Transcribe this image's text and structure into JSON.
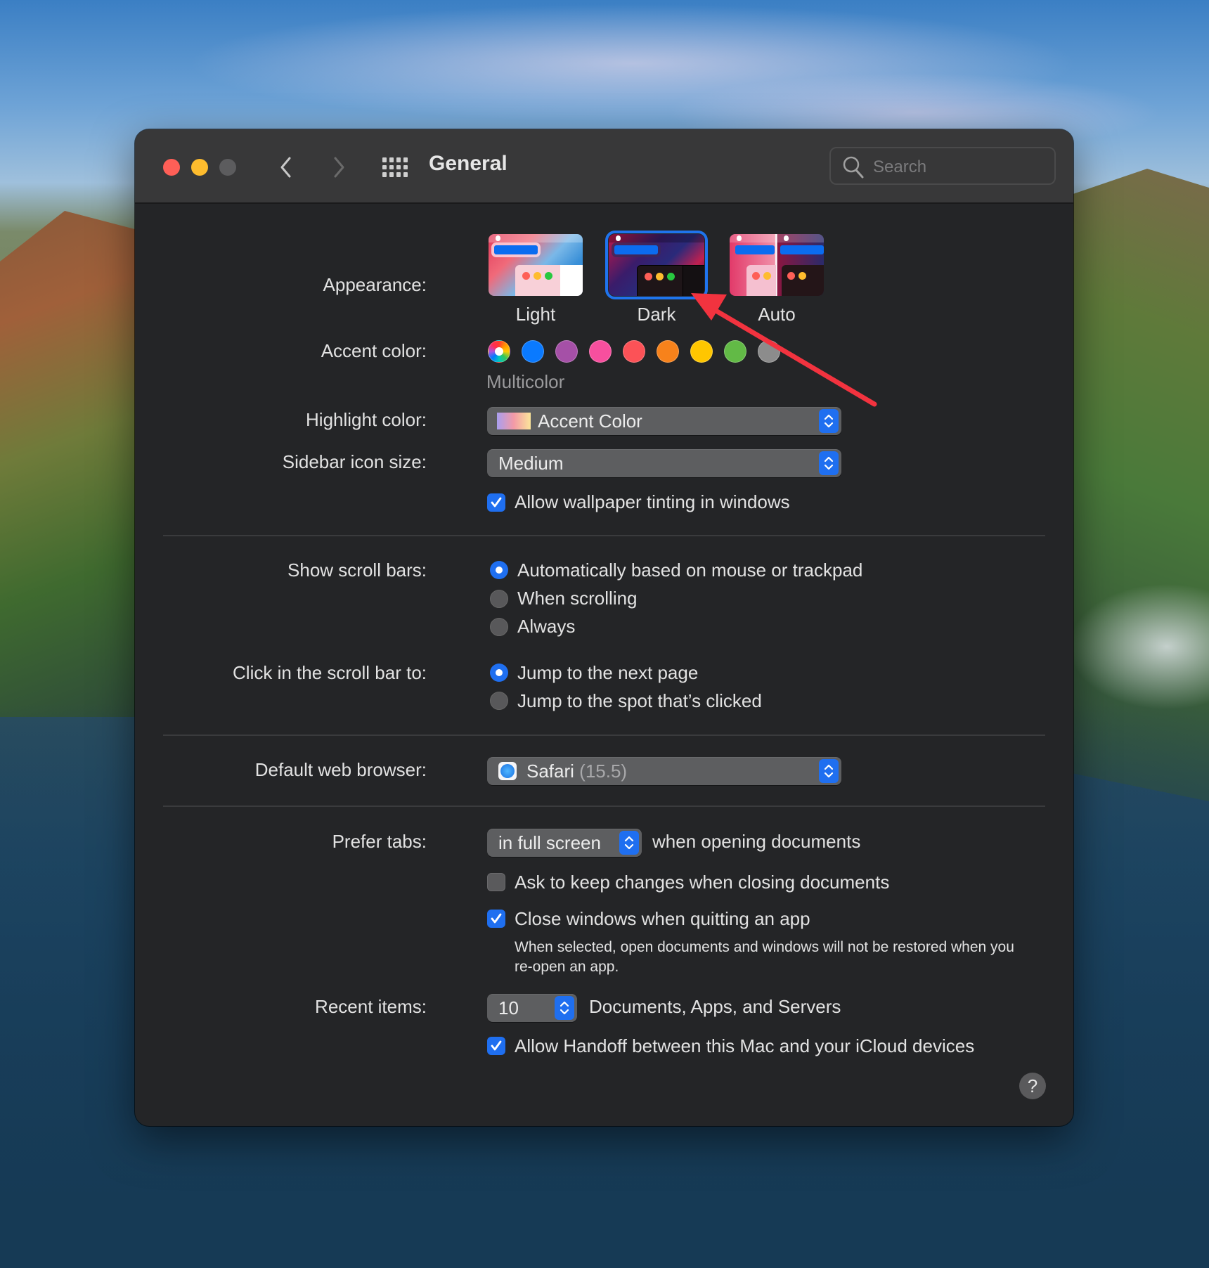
{
  "window": {
    "title": "General",
    "search_placeholder": "Search",
    "help_label": "?"
  },
  "appearance": {
    "label": "Appearance:",
    "options": [
      {
        "label": "Light",
        "selected": false
      },
      {
        "label": "Dark",
        "selected": true
      },
      {
        "label": "Auto",
        "selected": false
      }
    ]
  },
  "accent": {
    "label": "Accent color:",
    "selected_name": "Multicolor",
    "colors": [
      "multicolor",
      "#0a7aff",
      "#a550a7",
      "#f74f9e",
      "#fc5257",
      "#f7821b",
      "#ffc600",
      "#62ba46",
      "#8c8c8c"
    ]
  },
  "highlight": {
    "label": "Highlight color:",
    "value": "Accent Color"
  },
  "sidebar_icon_size": {
    "label": "Sidebar icon size:",
    "value": "Medium"
  },
  "wallpaper_tinting": {
    "label": "Allow wallpaper tinting in windows",
    "checked": true
  },
  "scroll_bars": {
    "label": "Show scroll bars:",
    "options": [
      {
        "label": "Automatically based on mouse or trackpad",
        "selected": true
      },
      {
        "label": "When scrolling",
        "selected": false
      },
      {
        "label": "Always",
        "selected": false
      }
    ]
  },
  "click_scroll": {
    "label": "Click in the scroll bar to:",
    "options": [
      {
        "label": "Jump to the next page",
        "selected": true
      },
      {
        "label": "Jump to the spot that’s clicked",
        "selected": false
      }
    ]
  },
  "browser": {
    "label": "Default web browser:",
    "name": "Safari",
    "version": "(15.5)"
  },
  "prefer_tabs": {
    "label": "Prefer tabs:",
    "value": "in full screen",
    "suffix": "when opening documents"
  },
  "ask_keep_changes": {
    "label": "Ask to keep changes when closing documents",
    "checked": false
  },
  "close_windows": {
    "label": "Close windows when quitting an app",
    "checked": true,
    "note": "When selected, open documents and windows will not be restored when you re-open an app."
  },
  "recent_items": {
    "label": "Recent items:",
    "value": "10",
    "suffix": "Documents, Apps, and Servers"
  },
  "handoff": {
    "label": "Allow Handoff between this Mac and your iCloud devices",
    "checked": true
  },
  "annotation": {
    "color": "#f2333f",
    "points_to": "Dark appearance option"
  }
}
